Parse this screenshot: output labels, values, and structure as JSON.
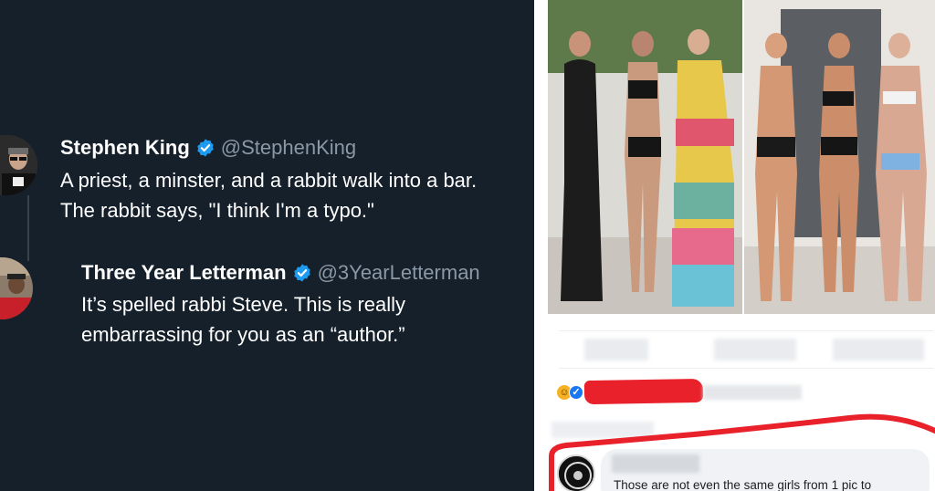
{
  "tweets": [
    {
      "name": "Stephen King",
      "handle": "@StephenKing",
      "verified": true,
      "lines": [
        "A priest, a minster, and a rabbit walk into a bar.",
        "The rabbit says, \"I think I'm a typo.\""
      ]
    },
    {
      "name": "Three Year Letterman",
      "handle": "@3YearLetterman",
      "verified": true,
      "lines": [
        "It’s spelled rabbi Steve. This is really",
        "embarrassing for you as an “author.”"
      ]
    }
  ],
  "colors": {
    "tweet_bg": "#15202b",
    "handle": "#8b98a5",
    "verified": "#1d9bf0",
    "highlight_red": "#e8212b"
  },
  "post": {
    "reaction_icons": [
      "haha-icon",
      "like-icon"
    ],
    "comment_text": "Those are not even the same girls from 1 pic to"
  }
}
